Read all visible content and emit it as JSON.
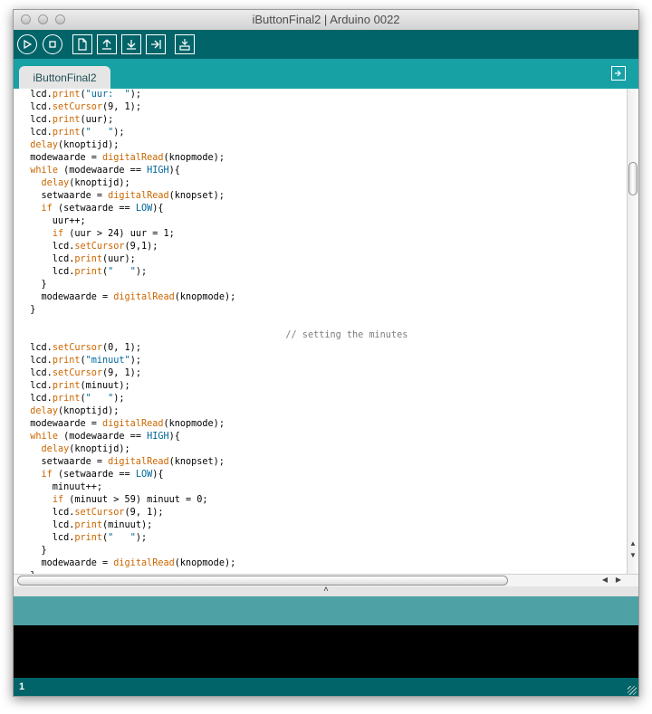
{
  "window": {
    "title": "iButtonFinal2 | Arduino 0022"
  },
  "toolbar": {
    "buttons": [
      {
        "name": "verify",
        "icon": "play-icon"
      },
      {
        "name": "stop",
        "icon": "stop-icon"
      },
      {
        "name": "new",
        "icon": "new-file-icon"
      },
      {
        "name": "open",
        "icon": "open-arrow-up-icon"
      },
      {
        "name": "save",
        "icon": "save-arrow-down-icon"
      },
      {
        "name": "upload",
        "icon": "upload-arrow-right-icon"
      },
      {
        "name": "serial-monitor",
        "icon": "monitor-icon"
      }
    ]
  },
  "tabs": [
    {
      "label": "iButtonFinal2"
    }
  ],
  "colors": {
    "toolbar": "#006468",
    "tabbar": "#17a1a5",
    "keyword": "#cc6600",
    "constant": "#006699",
    "comment": "#7e7e7e"
  },
  "editor": {
    "lines": [
      "  lcd.print(\"uur:  \");",
      "  lcd.setCursor(9, 1);",
      "  lcd.print(uur);",
      "  lcd.print(\"   \");",
      "  delay(knoptijd);",
      "  modewaarde = digitalRead(knopmode);",
      "  while (modewaarde == HIGH){",
      "    delay(knoptijd);",
      "    setwaarde = digitalRead(knopset);",
      "    if (setwaarde == LOW){",
      "      uur++;",
      "      if (uur > 24) uur = 1;",
      "      lcd.setCursor(9,1);",
      "      lcd.print(uur);",
      "      lcd.print(\"   \");",
      "    }",
      "    modewaarde = digitalRead(knopmode);",
      "  }",
      "",
      "                                                // setting the minutes",
      "  lcd.setCursor(0, 1);",
      "  lcd.print(\"minuut\");",
      "  lcd.setCursor(9, 1);",
      "  lcd.print(minuut);",
      "  lcd.print(\"   \");",
      "  delay(knoptijd);",
      "  modewaarde = digitalRead(knopmode);",
      "  while (modewaarde == HIGH){",
      "    delay(knoptijd);",
      "    setwaarde = digitalRead(knopset);",
      "    if (setwaarde == LOW){",
      "      minuut++;",
      "      if (minuut > 59) minuut = 0;",
      "      lcd.setCursor(9, 1);",
      "      lcd.print(minuut);",
      "      lcd.print(\"   \");",
      "    }",
      "    modewaarde = digitalRead(knopmode);",
      "  }"
    ]
  },
  "status": {
    "line_number": "1"
  }
}
